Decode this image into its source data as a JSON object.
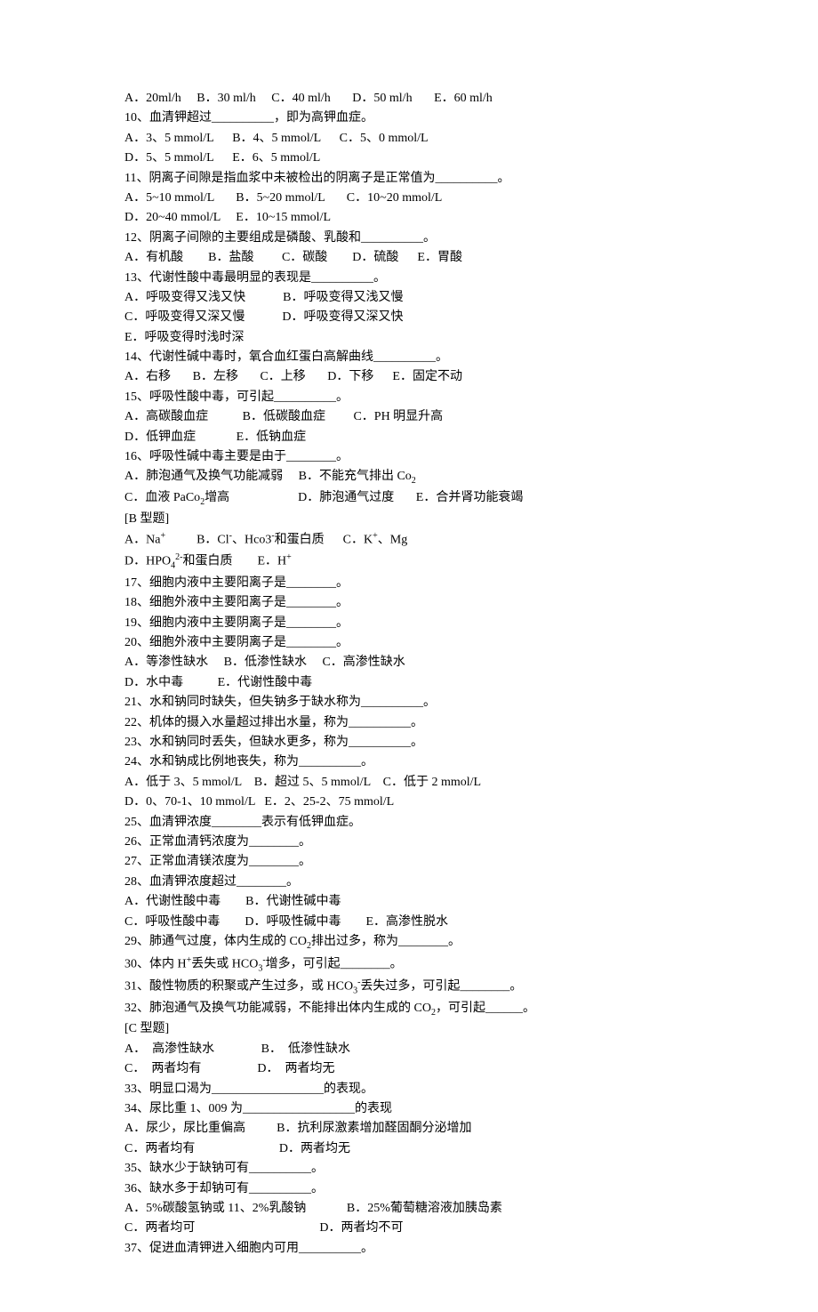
{
  "lines": [
    "A．20ml/h     B．30 ml/h     C．40 ml/h       D．50 ml/h       E．60 ml/h",
    "10、血清钾超过__________，即为高钾血症。",
    "A．3、5 mmol/L      B．4、5 mmol/L      C．5、0 mmol/L",
    "D．5、5 mmol/L      E．6、5 mmol/L",
    "11、阴离子间隙是指血浆中未被检出的阴离子是正常值为__________。",
    "A．5~10 mmol/L       B．5~20 mmol/L       C．10~20 mmol/L",
    "D．20~40 mmol/L     E．10~15 mmol/L",
    "12、阴离子间隙的主要组成是磷酸、乳酸和__________。",
    "A．有机酸        B．盐酸         C．碳酸        D．硫酸      E．胃酸",
    "13、代谢性酸中毒最明显的表现是__________。",
    "A．呼吸变得又浅又快            B．呼吸变得又浅又慢",
    "C．呼吸变得又深又慢            D．呼吸变得又深又快",
    "E．呼吸变得时浅时深",
    "14、代谢性碱中毒时，氧合血红蛋白高解曲线__________。",
    "A．右移       B．左移       C．上移       D．下移      E．固定不动",
    "15、呼吸性酸中毒，可引起__________。",
    "A．高碳酸血症           B．低碳酸血症         C．PH 明显升高",
    "D．低钾血症             E．低钠血症",
    "16、呼吸性碱中毒主要是由于________。",
    "A．肺泡通气及换气功能减弱     B．不能充气排出 Co₂",
    "C．血液 PaCo₂增高                      D．肺泡通气过度       E．合并肾功能衰竭",
    "[B 型题]",
    "A．Na⁺          B．Cl⁻、Hco3⁻和蛋白质      C．K⁺、Mg",
    "D．HPO₄²⁻和蛋白质        E．H⁺",
    "17、细胞内液中主要阳离子是________。",
    "18、细胞外液中主要阳离子是________。",
    "19、细胞内液中主要阴离子是________。",
    "20、细胞外液中主要阴离子是________。",
    "A．等渗性缺水     B．低渗性缺水     C．高渗性缺水",
    "D．水中毒           E．代谢性酸中毒",
    "21、水和钠同时缺失，但失钠多于缺水称为__________。",
    "22、机体的摄入水量超过排出水量，称为__________。",
    "23、水和钠同时丢失，但缺水更多，称为__________。",
    "24、水和钠成比例地丧失，称为__________。",
    "A．低于 3、5 mmol/L    B．超过 5、5 mmol/L    C．低于 2 mmol/L",
    "D．0、70-1、10 mmol/L   E．2、25-2、75 mmol/L",
    "25、血清钾浓度________表示有低钾血症。",
    "26、正常血清钙浓度为________。",
    "27、正常血清镁浓度为________。",
    "28、血清钾浓度超过________。",
    "A．代谢性酸中毒        B．代谢性碱中毒",
    "C．呼吸性酸中毒        D．呼吸性碱中毒        E．高渗性脱水",
    "29、肺通气过度，体内生成的 CO₂排出过多，称为________。",
    "30、体内 H⁺丢失或 HCO₃⁻增多，可引起________。",
    "31、酸性物质的积聚或产生过多，或 HCO₃⁻丢失过多，可引起________。",
    "32、肺泡通气及换气功能减弱，不能排出体内生成的 CO₂，可引起______。",
    "[C 型题]",
    "A．  高渗性缺水               B．  低渗性缺水",
    "C．  两者均有                  D．  两者均无",
    "33、明显口渴为__________________的表现。",
    "34、尿比重 1、009 为__________________的表现",
    "A．尿少，尿比重偏高          B．抗利尿激素增加醛固酮分泌增加",
    "C．两者均有                           D．两者均无",
    "35、缺水少于缺钠可有__________。",
    "36、缺水多于却钠可有__________。",
    "A．5%碳酸氢钠或 11、2%乳酸钠             B．25%葡萄糖溶液加胰岛素",
    "C．两者均可                                        D．两者均不可",
    "37、促进血清钾进入细胞内可用__________。"
  ]
}
